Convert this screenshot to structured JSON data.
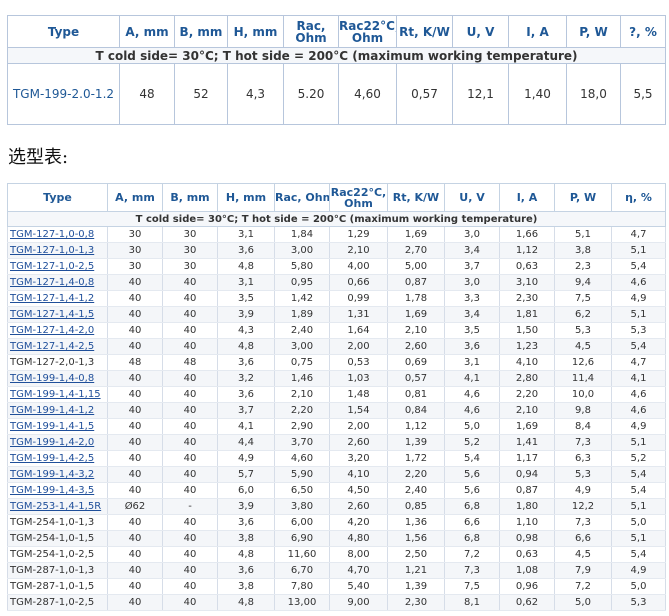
{
  "table1": {
    "headers": [
      "Type",
      "A, mm",
      "B, mm",
      "H, mm",
      "Rac,\nOhm",
      "Rac22°C,\nOhm",
      "Rt, K/W",
      "U, V",
      "I, A",
      "P, W",
      "?, %"
    ],
    "condition": "T cold side= 30°C; T hot side = 200°C (maximum working temperature)",
    "row": [
      "TGM-199-2.0-1.2",
      "48",
      "52",
      "4,3",
      "5.20",
      "4,60",
      "0,57",
      "12,1",
      "1,40",
      "18,0",
      "5,5"
    ]
  },
  "heading": "选型表:",
  "table2": {
    "headers": [
      "Type",
      "A, mm",
      "B, mm",
      "H, mm",
      "Rac, Ohm",
      "Rac22°C,\nOhm",
      "Rt, K/W",
      "U, V",
      "I, A",
      "P, W",
      "η, %"
    ],
    "condition": "T cold side= 30°C; T hot side = 200°C (maximum working temperature)",
    "rows": [
      {
        "link": true,
        "cells": [
          "TGM-127-1,0-0,8",
          "30",
          "30",
          "3,1",
          "1,84",
          "1,29",
          "1,69",
          "3,0",
          "1,66",
          "5,1",
          "4,7"
        ]
      },
      {
        "link": true,
        "cells": [
          "TGM-127-1,0-1,3",
          "30",
          "30",
          "3,6",
          "3,00",
          "2,10",
          "2,70",
          "3,4",
          "1,12",
          "3,8",
          "5,1"
        ]
      },
      {
        "link": true,
        "cells": [
          "TGM-127-1,0-2,5",
          "30",
          "30",
          "4,8",
          "5,80",
          "4,00",
          "5,00",
          "3,7",
          "0,63",
          "2,3",
          "5,4"
        ]
      },
      {
        "link": true,
        "cells": [
          "TGM-127-1,4-0,8",
          "40",
          "40",
          "3,1",
          "0,95",
          "0,66",
          "0,87",
          "3,0",
          "3,10",
          "9,4",
          "4,6"
        ]
      },
      {
        "link": true,
        "cells": [
          "TGM-127-1,4-1,2",
          "40",
          "40",
          "3,5",
          "1,42",
          "0,99",
          "1,78",
          "3,3",
          "2,30",
          "7,5",
          "4,9"
        ]
      },
      {
        "link": true,
        "cells": [
          "TGM-127-1,4-1,5",
          "40",
          "40",
          "3,9",
          "1,89",
          "1,31",
          "1,69",
          "3,4",
          "1,81",
          "6,2",
          "5,1"
        ]
      },
      {
        "link": true,
        "cells": [
          "TGM-127-1,4-2,0",
          "40",
          "40",
          "4,3",
          "2,40",
          "1,64",
          "2,10",
          "3,5",
          "1,50",
          "5,3",
          "5,3"
        ]
      },
      {
        "link": true,
        "cells": [
          "TGM-127-1,4-2,5",
          "40",
          "40",
          "4,8",
          "3,00",
          "2,00",
          "2,60",
          "3,6",
          "1,23",
          "4,5",
          "5,4"
        ]
      },
      {
        "link": false,
        "cells": [
          "TGM-127-2,0-1,3",
          "48",
          "48",
          "3,6",
          "0,75",
          "0,53",
          "0,69",
          "3,1",
          "4,10",
          "12,6",
          "4,7"
        ]
      },
      {
        "link": true,
        "cells": [
          "TGM-199-1,4-0,8",
          "40",
          "40",
          "3,2",
          "1,46",
          "1,03",
          "0,57",
          "4,1",
          "2,80",
          "11,4",
          "4,1"
        ]
      },
      {
        "link": true,
        "cells": [
          "TGM-199-1,4-1,15",
          "40",
          "40",
          "3,6",
          "2,10",
          "1,48",
          "0,81",
          "4,6",
          "2,20",
          "10,0",
          "4,6"
        ]
      },
      {
        "link": true,
        "cells": [
          "TGM-199-1,4-1,2",
          "40",
          "40",
          "3,7",
          "2,20",
          "1,54",
          "0,84",
          "4,6",
          "2,10",
          "9,8",
          "4,6"
        ]
      },
      {
        "link": true,
        "cells": [
          "TGM-199-1,4-1,5",
          "40",
          "40",
          "4,1",
          "2,90",
          "2,00",
          "1,12",
          "5,0",
          "1,69",
          "8,4",
          "4,9"
        ]
      },
      {
        "link": true,
        "cells": [
          "TGM-199-1,4-2,0",
          "40",
          "40",
          "4,4",
          "3,70",
          "2,60",
          "1,39",
          "5,2",
          "1,41",
          "7,3",
          "5,1"
        ]
      },
      {
        "link": true,
        "cells": [
          "TGM-199-1,4-2,5",
          "40",
          "40",
          "4,9",
          "4,60",
          "3,20",
          "1,72",
          "5,4",
          "1,17",
          "6,3",
          "5,2"
        ]
      },
      {
        "link": true,
        "cells": [
          "TGM-199-1,4-3,2",
          "40",
          "40",
          "5,7",
          "5,90",
          "4,10",
          "2,20",
          "5,6",
          "0,94",
          "5,3",
          "5,4"
        ]
      },
      {
        "link": true,
        "cells": [
          "TGM-199-1,4-3,5",
          "40",
          "40",
          "6,0",
          "6,50",
          "4,50",
          "2,40",
          "5,6",
          "0,87",
          "4,9",
          "5,4"
        ]
      },
      {
        "link": true,
        "cells": [
          "TGM-253-1,4-1,5R",
          "Ø62",
          "-",
          "3,9",
          "3,80",
          "2,60",
          "0,85",
          "6,8",
          "1,80",
          "12,2",
          "5,1"
        ]
      },
      {
        "link": false,
        "cells": [
          "TGM-254-1,0-1,3",
          "40",
          "40",
          "3,6",
          "6,00",
          "4,20",
          "1,36",
          "6,6",
          "1,10",
          "7,3",
          "5,0"
        ]
      },
      {
        "link": false,
        "cells": [
          "TGM-254-1,0-1,5",
          "40",
          "40",
          "3,8",
          "6,90",
          "4,80",
          "1,56",
          "6,8",
          "0,98",
          "6,6",
          "5,1"
        ]
      },
      {
        "link": false,
        "cells": [
          "TGM-254-1,0-2,5",
          "40",
          "40",
          "4,8",
          "11,60",
          "8,00",
          "2,50",
          "7,2",
          "0,63",
          "4,5",
          "5,4"
        ]
      },
      {
        "link": false,
        "cells": [
          "TGM-287-1,0-1,3",
          "40",
          "40",
          "3,6",
          "6,70",
          "4,70",
          "1,21",
          "7,3",
          "1,08",
          "7,9",
          "4,9"
        ]
      },
      {
        "link": false,
        "cells": [
          "TGM-287-1,0-1,5",
          "40",
          "40",
          "3,8",
          "7,80",
          "5,40",
          "1,39",
          "7,5",
          "0,96",
          "7,2",
          "5,0"
        ]
      },
      {
        "link": false,
        "cells": [
          "TGM-287-1,0-2,5",
          "40",
          "40",
          "4,8",
          "13,00",
          "9,00",
          "2,30",
          "8,1",
          "0,62",
          "5,0",
          "5,3"
        ]
      }
    ]
  }
}
